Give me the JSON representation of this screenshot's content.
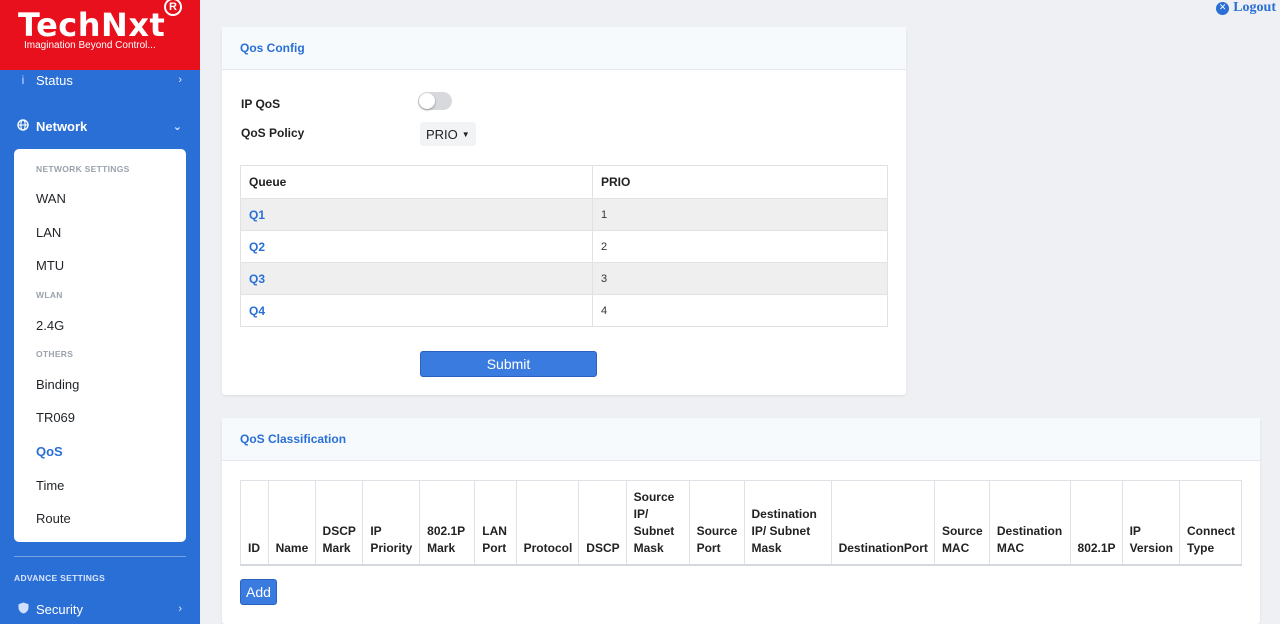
{
  "brand": {
    "name": "TechNxt",
    "registered": "R",
    "tagline": "Imagination Beyond Control..."
  },
  "header": {
    "logout_label": "Logout"
  },
  "sidebar": {
    "status_label": "Status",
    "network_label": "Network",
    "network_settings_head": "NETWORK SETTINGS",
    "wan": "WAN",
    "lan": "LAN",
    "mtu": "MTU",
    "wlan_head": "WLAN",
    "wifi_24": "2.4G",
    "others_head": "OTHERS",
    "binding": "Binding",
    "tr069": "TR069",
    "qos": "QoS",
    "time": "Time",
    "route": "Route",
    "advance_head": "ADVANCE SETTINGS",
    "security_label": "Security"
  },
  "qos_config": {
    "title": "Qos Config",
    "ip_qos_label": "IP QoS",
    "ip_qos_enabled": false,
    "policy_label": "QoS Policy",
    "policy_value": "PRIO",
    "table_headers": [
      "Queue",
      "PRIO"
    ],
    "rows": [
      {
        "queue": "Q1",
        "prio": "1"
      },
      {
        "queue": "Q2",
        "prio": "2"
      },
      {
        "queue": "Q3",
        "prio": "3"
      },
      {
        "queue": "Q4",
        "prio": "4"
      }
    ],
    "submit_label": "Submit"
  },
  "qos_classification": {
    "title": "QoS Classification",
    "columns": [
      "ID",
      "Name",
      "DSCP Mark",
      "IP Priority",
      "802.1P Mark",
      "LAN Port",
      "Protocol",
      "DSCP",
      "Source IP/ Subnet Mask",
      "Source Port",
      "Destination IP/ Subnet Mask",
      "DestinationPort",
      "Source MAC",
      "Destination MAC",
      "802.1P",
      "IP Version",
      "Connect Type"
    ],
    "add_label": "Add"
  },
  "colors": {
    "sidebar": "#2a6fd6",
    "logo_bg": "#e8101c",
    "accent": "#2a6fd6",
    "button": "#3a7be0"
  }
}
